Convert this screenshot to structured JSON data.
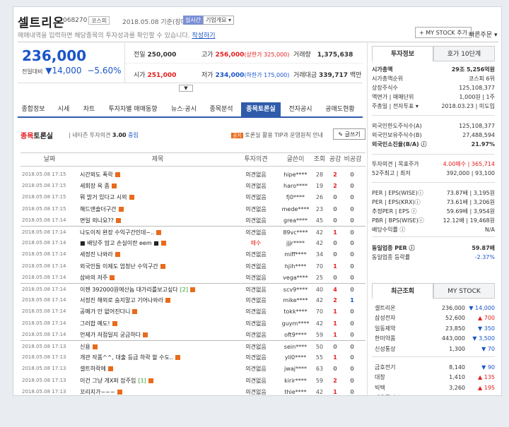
{
  "header": {
    "stock_name": "셀트리온",
    "stock_code": "068270",
    "market": "코스피",
    "date_note": "2018.05.08 기준(장마감)",
    "realtime_label": "실시간",
    "company_label": "기업개요 ▾",
    "description": "매매내역을 입력하면 해당종목의 투자성과를 확인할 수 있습니다.",
    "description_link": "작성하기",
    "mystock_label": "+ MY STOCK 추가",
    "quick_order_label": "빠른주문 ▾"
  },
  "price": {
    "current": "236,000",
    "change_label": "전일대비",
    "change": "▼14,000",
    "change_pct": "−5.60%",
    "prev_close_label": "전일",
    "prev_close": "250,000",
    "high_label": "고가",
    "high": "256,000",
    "upper_limit": "(상한가 325,000)",
    "volume_label": "거래량",
    "volume": "1,375,638",
    "open_label": "시가",
    "open": "251,000",
    "low_label": "저가",
    "low": "234,000",
    "lower_limit": "(하한가 175,000)",
    "amount_label": "거래대금",
    "amount": "339,717",
    "amount_unit": "백만",
    "expand_icon": "chevron-down"
  },
  "tabs": [
    "종합정보",
    "시세",
    "차트",
    "투자자별 매매동향",
    "뉴스·공시",
    "종목분석",
    "종목토론실",
    "전자공시",
    "공매도현황"
  ],
  "active_tab": 6,
  "board": {
    "title_em": "종목",
    "title_rest": "토론실",
    "sub_label": "네티즌 투자의견",
    "sub_score": "3.00",
    "sub_level": "중립",
    "notice_tag": "공지",
    "notice": "토론실 활용 TIP과 운영원칙 안내",
    "write_label": "글쓰기"
  },
  "columns": [
    "날짜",
    "제목",
    "투자의견",
    "글쓴이",
    "조회",
    "공감",
    "비공감"
  ],
  "rows": [
    {
      "date": "2018.05.08 17:15",
      "title": "시간외도 폭락",
      "cmt": "",
      "op": "의견없음",
      "user": "hipe****",
      "views": "28",
      "like": "2",
      "dislike": "0"
    },
    {
      "date": "2018.05.08 17:15",
      "title": "세회장 욕 좀",
      "cmt": "",
      "op": "의견없음",
      "user": "haro****",
      "views": "19",
      "like": "2",
      "dislike": "0"
    },
    {
      "date": "2018.05.08 17:15",
      "title": "뭐 밝거 있다고 시외",
      "cmt": "",
      "op": "의견없음",
      "user": "fj0****",
      "views": "26",
      "like": "0",
      "dislike": "0"
    },
    {
      "date": "2018.05.08 17:15",
      "title": "해드앤숄더구간",
      "cmt": "",
      "op": "의견없음",
      "user": "mede****",
      "views": "23",
      "like": "0",
      "dislike": "0"
    },
    {
      "date": "2018.05.08 17:14",
      "title": "면일 외나요??",
      "cmt": "",
      "op": "의견없음",
      "user": "grea****",
      "views": "45",
      "like": "0",
      "dislike": "0"
    },
    {
      "date": "2018.05.08 17:14",
      "title": "나도이직 완장 수익구간인데~..",
      "cmt": "",
      "op": "의견없음",
      "user": "89vc****",
      "views": "42",
      "like": "1",
      "dislike": "0"
    },
    {
      "date": "2018.05.08 17:14",
      "title": "■ 배당주 맘고 손실이란 eem ■",
      "cmt": "",
      "op": "매수",
      "user": "jjjr****",
      "views": "42",
      "like": "0",
      "dislike": "0"
    },
    {
      "date": "2018.05.08 17:14",
      "title": "세정진 나와라",
      "cmt": "",
      "op": "의견없음",
      "user": "miff****",
      "views": "34",
      "like": "0",
      "dislike": "0"
    },
    {
      "date": "2018.05.08 17:14",
      "title": "외국인들 이제도 엄청난 수익구간",
      "cmt": "",
      "op": "의견없음",
      "user": "hjih****",
      "views": "70",
      "like": "1",
      "dislike": "0"
    },
    {
      "date": "2018.05.08 17:14",
      "title": "삼바의 저주",
      "cmt": "",
      "op": "의견없음",
      "user": "vega****",
      "views": "25",
      "like": "0",
      "dislike": "0"
    },
    {
      "date": "2018.05.08 17:14",
      "title": "이젠 392000원에산놈 대가리를보고싶다",
      "cmt": "[2]",
      "op": "의견없음",
      "user": "scv9****",
      "views": "40",
      "like": "4",
      "dislike": "0"
    },
    {
      "date": "2018.05.08 17:14",
      "title": "서정진 해외로 숨지말고 기어나와라",
      "cmt": "",
      "op": "의견없음",
      "user": "mike****",
      "views": "42",
      "like": "2",
      "dislike": "1"
    },
    {
      "date": "2018.05.08 17:14",
      "title": "공매가 안 없어진다니",
      "cmt": "",
      "op": "의견없음",
      "user": "tokk****",
      "views": "70",
      "like": "1",
      "dislike": "0"
    },
    {
      "date": "2018.05.08 17:14",
      "title": "그러합 예도!",
      "cmt": "",
      "op": "의견없음",
      "user": "guym****",
      "views": "42",
      "like": "1",
      "dislike": "0"
    },
    {
      "date": "2018.05.08 17:14",
      "title": "언제가 저점일지 궁금하다",
      "cmt": "",
      "op": "의견없음",
      "user": "oft9****",
      "views": "59",
      "like": "1",
      "dislike": "0"
    },
    {
      "date": "2018.05.08 17:13",
      "title": "신용",
      "cmt": "",
      "op": "의견없음",
      "user": "sein****",
      "views": "50",
      "like": "0",
      "dislike": "0"
    },
    {
      "date": "2018.05.08 17:13",
      "title": "개관 작품^^, 대출 등급 하락 할 수도..",
      "cmt": "",
      "op": "의견없음",
      "user": "yll0****",
      "views": "55",
      "like": "1",
      "dislike": "0"
    },
    {
      "date": "2018.05.08 17:13",
      "title": "셀트하락에",
      "cmt": "",
      "op": "의견없음",
      "user": "jwaj****",
      "views": "63",
      "like": "0",
      "dislike": "0"
    },
    {
      "date": "2018.05.08 17:13",
      "title": "이건 그냥 개X퍼 잡주임",
      "cmt": "[1]",
      "op": "의견없음",
      "user": "kirir****",
      "views": "59",
      "like": "2",
      "dislike": "0"
    },
    {
      "date": "2018.05.08 17:13",
      "title": "꼬리지가~~~",
      "cmt": "",
      "op": "의견없음",
      "user": "thie****",
      "views": "42",
      "like": "1",
      "dislike": "0"
    }
  ],
  "right": {
    "tab_info": "투자정보",
    "tab_quote": "호가 10단계",
    "info": [
      {
        "k": "시가총액",
        "v": "29조 5,256억원",
        "bold": true
      },
      {
        "k": "시가총액순위",
        "v": "코스피 6위"
      },
      {
        "k": "상장주식수",
        "v": "125,108,377"
      },
      {
        "k": "액면가 | 매매단위",
        "v": "1,000원 | 1주"
      },
      {
        "k": "주총일 | 전자투표 ▾",
        "v": "2018.03.23 | 미도입"
      },
      {
        "k": "외국인한도주식수(A)",
        "v": "125,108,377"
      },
      {
        "k": "외국인보유주식수(B)",
        "v": "27,488,594"
      },
      {
        "k": "외국인소진율(B/A) ⓘ",
        "v": "21.97%",
        "bold": true
      },
      {
        "k": "투자의견 | 목표주가",
        "v": "4.00매수 | 365,714",
        "red": true
      },
      {
        "k": "52주최고 | 최저",
        "v": "392,000 | 93,100"
      },
      {
        "k": "PER | EPS(WISE)ⓘ",
        "v": "73.87배 | 3,195원"
      },
      {
        "k": "PER | EPS(KRX)ⓘ",
        "v": "73.61배 | 3,206원"
      },
      {
        "k": "추정PER | EPS ⓘ",
        "v": "59.69배 | 3,954원"
      },
      {
        "k": "PBR | BPS(WISE)ⓘ",
        "v": "12.12배 | 19,468원"
      },
      {
        "k": "배당수익률 ⓘ",
        "v": "N/A"
      },
      {
        "k": "동일업종 PER ⓘ",
        "v": "59.87배",
        "bold": true
      },
      {
        "k": "동일업종 등락률",
        "v": "-2.37%",
        "blue": true
      }
    ],
    "tab_recent": "최근조회",
    "tab_mystock": "MY STOCK",
    "recent": [
      {
        "n": "셀트리온",
        "p": "236,000",
        "c": "▼ 14,000",
        "dir": "down"
      },
      {
        "n": "삼성전자",
        "p": "52,600",
        "c": "▲ 700",
        "dir": "up"
      },
      {
        "n": "일동제약",
        "p": "23,850",
        "c": "▼ 350",
        "dir": "down"
      },
      {
        "n": "한미약품",
        "p": "443,000",
        "c": "▼ 3,500",
        "dir": "down"
      },
      {
        "n": "신성통상",
        "p": "1,300",
        "c": "▼ 70",
        "dir": "down"
      },
      {
        "n": "금호전기",
        "p": "8,140",
        "c": "▼ 90",
        "dir": "down"
      },
      {
        "n": "대창",
        "p": "1,410",
        "c": "▲ 135",
        "dir": "up"
      },
      {
        "n": "빅텍",
        "p": "3,260",
        "c": "▲ 195",
        "dir": "up"
      },
      {
        "n": "대유플러스",
        "p": "1,165",
        "c": "▲ 45",
        "dir": "up"
      }
    ]
  },
  "colors": {
    "up": "#e41c1c",
    "down": "#1a55c9",
    "accent": "#2f5baa",
    "tag": "#e86b1b"
  }
}
